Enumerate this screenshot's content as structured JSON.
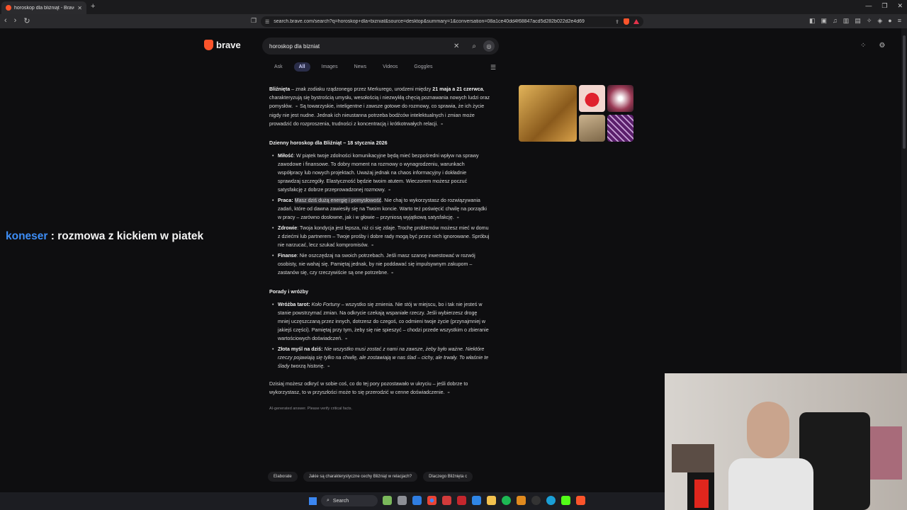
{
  "browser": {
    "tab_title": "horoskop dla bliźniąt - Brave Sea",
    "new_tab": "+",
    "url": "search.brave.com/search?q=horoskop+dla+bizniat&source=desktop&summary=1&conversation=08a1ce40dd4f68847acd5d282b022d2e4d69"
  },
  "brand": {
    "name": "brave",
    "color": "#fb542b"
  },
  "search": {
    "query": "horoskop dla bizniat"
  },
  "tabs": [
    "Ask",
    "All",
    "Images",
    "News",
    "Videos",
    "Goggles"
  ],
  "active_tab": "All",
  "answer": {
    "intro_bold1": "Bliźnięta",
    "intro_1": " – znak zodiaku rządzonego przez Merkurego, urodzeni między ",
    "intro_bold2": "21 maja a 21 czerwca",
    "intro_2": ", charakteryzują się bystrością umysłu, wesołością i niezwykłą chęcią poznawania nowych ludzi oraz pomysłów.",
    "intro_3": " Są towarzyskie, inteligentne i zawsze gotowe do rozmowy, co sprawia, że ich życie nigdy nie jest nudne. Jednak ich nieustanna potrzeba bodźców intelektualnych i zmian może prowadzić do rozproszenia, trudności z koncentracją i krótkotrwałych relacji.",
    "daily_heading": "Dzienny horoskop dla Bliźniąt – 18 stycznia 2026",
    "daily": [
      {
        "label": "Miłość",
        "text": ": W piątek twoje zdolności komunikacyjne będą mieć bezpośredni wpływ na sprawy zawodowe i finansowe. To dobry moment na rozmowy o wynagrodzeniu, warunkach współpracy lub nowych projektach. Uważaj jednak na chaos informacyjny i dokładnie sprawdzaj szczegóły. Elastyczność będzie twoim atutem. Wieczorem możesz poczuć satysfakcję z dobrze przeprowadzonej rozmowy."
      },
      {
        "label": "Praca",
        "highlight": "Masz dziś dużą energię i pomysłowość",
        "text": ". Nie chaj to wykorzystasz do rozwiązywania zadań, które od dawna zawiesiły się na Twoim koncie. Warto też poświęcić chwilę na porządki w pracy – zarówno dosłowne, jak i w głowie – przyniosą wyjątkową satysfakcję."
      },
      {
        "label": "Zdrowie",
        "text": ": Twoja kondycja jest lepsza, niż ci się zdaje. Trochę problemów możesz mieć w domu z dziećmi lub partnerem – Twoje prośby i dobre rady mogą być przez nich ignorowane. Spróbuj nie narzucać, lecz szukać kompromisów."
      },
      {
        "label": "Finanse",
        "text": ": Nie oszczędzaj na swoich potrzebach. Jeśli masz szansę inwestować w rozwój osobisty, nie wahaj się. Pamiętaj jednak, by nie poddawać się impulsywnym zakupom – zastanów się, czy rzeczywiście są one potrzebne."
      }
    ],
    "tips_heading": "Porady i wróżby",
    "tips": [
      {
        "label": "Wróżba tarot",
        "italic": "Koło Fortuny",
        "text": " – wszystko się zmienia. Nie stój w miejscu, bo i tak nie jesteś w stanie powstrzymać zmian. Na odkrycie czekają wspaniałe rzeczy. Jeśli wybierzesz drogę mniej uczęszczaną przez innych, dotrzesz do czegoś, co odmieni twoje życie (przynajmniej w jakiejś części). Pamiętaj przy tym, żeby się nie spieszyć – chodzi przede wszystkim o zbieranie wartościowych doświadczeń."
      },
      {
        "label": "Złota myśl na dziś",
        "italic": "Nie wszystko musi zostać z nami na zawsze, żeby było ważne. Niektóre rzeczy pojawiają się tylko na chwilę, ale zostawiają w nas ślad – cichy, ale trwały. To właśnie te ślady tworzą historię.",
        "text": ""
      }
    ],
    "closing": "Dzisiaj możesz odkryć w sobie coś, co do tej pory pozostawało w ukryciu – jeśli dobrze to wykorzystasz, to w przyszłości może to się przerodzić w cenne doświadczenie.",
    "disclaimer": "AI-generated answer. Please verify critical facts."
  },
  "followups": [
    "Elaborate",
    "Jakie są charakterystyczne cechy Bliźniąt w relacjach?",
    "Dlaczego Bliźnięta c"
  ],
  "overlay": {
    "name": "koneser",
    "rest": " : rozmowa z kickiem w piatek"
  },
  "taskbar": {
    "search_label": "Search"
  }
}
